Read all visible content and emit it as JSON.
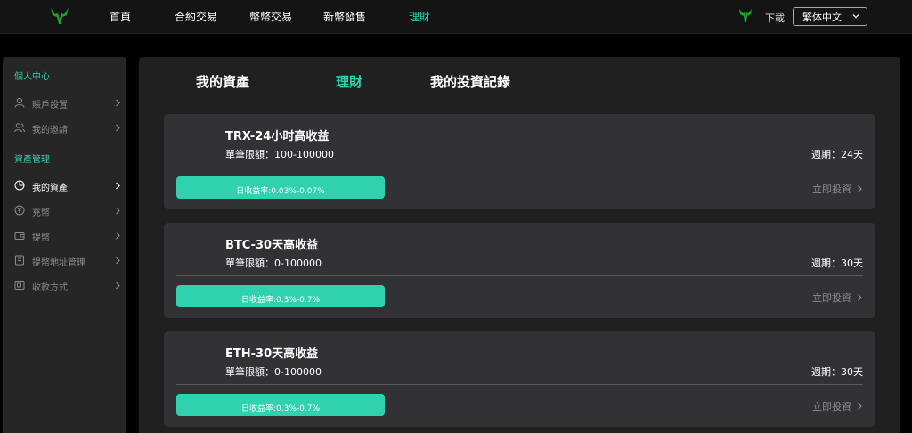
{
  "header": {
    "nav": [
      {
        "id": "home",
        "label": "首頁"
      },
      {
        "id": "contract",
        "label": "合約交易"
      },
      {
        "id": "spot",
        "label": "幣幣交易"
      },
      {
        "id": "ipo",
        "label": "新幣發售"
      },
      {
        "id": "finance",
        "label": "理財",
        "active": true
      }
    ],
    "download_label": "下載",
    "language": "繁体中文"
  },
  "sidebar": {
    "sections": [
      {
        "title": "個人中心",
        "items": [
          {
            "label": "賬戶設置",
            "icon": "user-icon"
          },
          {
            "label": "我的邀請",
            "icon": "users-icon"
          }
        ]
      },
      {
        "title": "資產管理",
        "items": [
          {
            "label": "我的資產",
            "icon": "pie-chart-icon",
            "active": true
          },
          {
            "label": "充幣",
            "icon": "coin-icon"
          },
          {
            "label": "提幣",
            "icon": "wallet-icon"
          },
          {
            "label": "提幣地址管理",
            "icon": "address-book-icon"
          },
          {
            "label": "收款方式",
            "icon": "payment-icon"
          }
        ]
      }
    ]
  },
  "main": {
    "tabs": [
      {
        "label": "我的資產"
      },
      {
        "label": "理財",
        "active": true
      },
      {
        "label": "我的投資記錄"
      }
    ],
    "products": [
      {
        "title": "TRX-24小时高收益",
        "limit": "單筆限額：100-100000",
        "period": "週期：24天",
        "rate": "日收益率:0.03%-0.07%",
        "action": "立即投資"
      },
      {
        "title": "BTC-30天高收益",
        "limit": "單筆限額：0-100000",
        "period": "週期：30天",
        "rate": "日收益率:0.3%-0.7%",
        "action": "立即投資"
      },
      {
        "title": "ETH-30天高收益",
        "limit": "單筆限額：0-100000",
        "period": "週期：30天",
        "rate": "日收益率:0.3%-0.7%",
        "action": "立即投資"
      }
    ]
  },
  "colors": {
    "accent": "#2fd1ae",
    "card": "#323235",
    "panel": "#202020",
    "sidebar": "#262626",
    "logo": "#1fa32b"
  }
}
